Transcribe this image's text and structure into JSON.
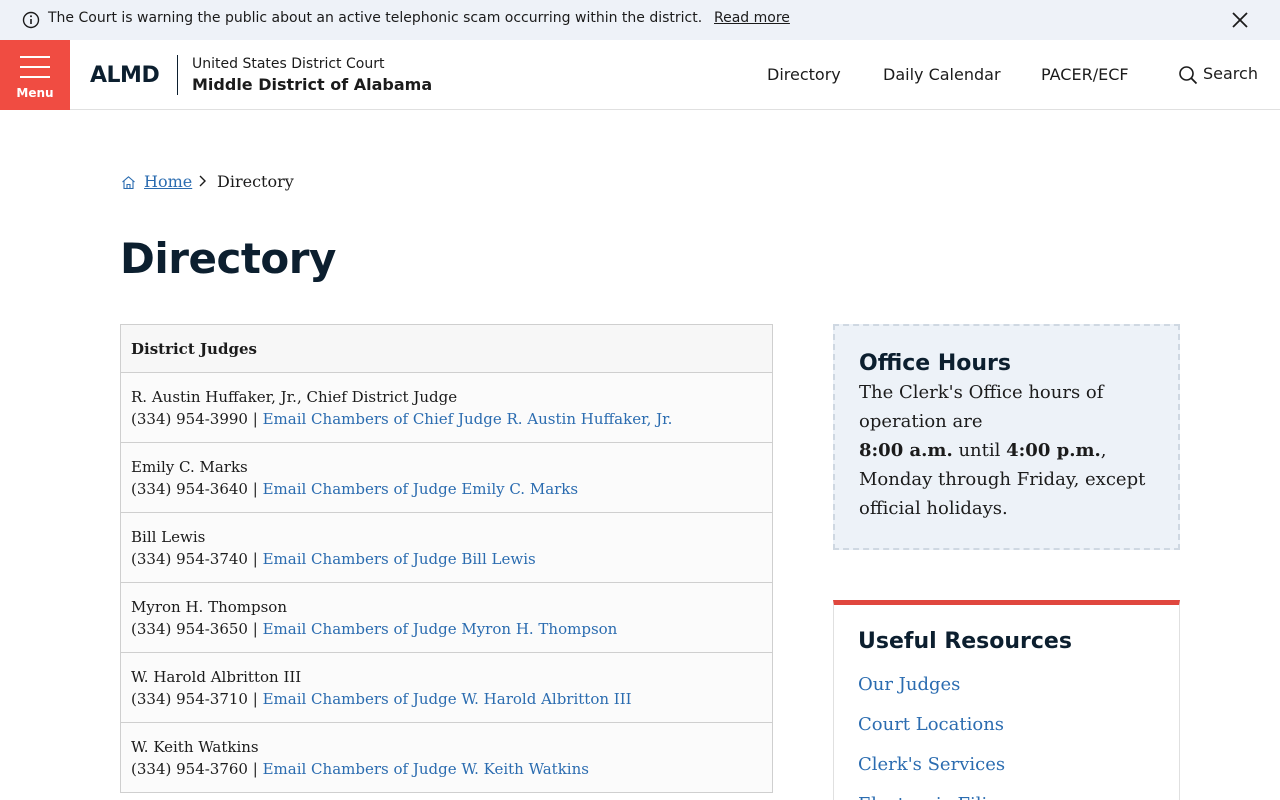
{
  "alert": {
    "message": "The Court is warning the public about an active telephonic scam occurring within the district.",
    "link": "Read more"
  },
  "header": {
    "menu_label": "Menu",
    "logo": "ALMD",
    "court_line1": "United States District Court",
    "court_line2": "Middle District of Alabama",
    "nav": [
      "Directory",
      "Daily Calendar",
      "PACER/ECF"
    ],
    "search_label": "Search"
  },
  "breadcrumb": {
    "home": "Home",
    "current": "Directory"
  },
  "page_title": "Directory",
  "table": {
    "header": "District Judges",
    "rows": [
      {
        "name": "R. Austin Huffaker, Jr., Chief District Judge",
        "phone": "(334) 954-3990",
        "sep": " | ",
        "email": "Email Chambers of Chief Judge R. Austin Huffaker, Jr."
      },
      {
        "name": "Emily C. Marks",
        "phone": "(334) 954-3640",
        "sep": " | ",
        "email": "Email Chambers of Judge Emily C. Marks"
      },
      {
        "name": "Bill Lewis",
        "phone": "(334) 954-3740",
        "sep": " | ",
        "email": "Email Chambers of Judge Bill Lewis"
      },
      {
        "name": "Myron H. Thompson",
        "phone": "(334) 954-3650",
        "sep": " | ",
        "email": "Email Chambers of Judge Myron H. Thompson"
      },
      {
        "name": "W. Harold Albritton III",
        "phone": "(334) 954-3710",
        "sep": " | ",
        "email": "Email Chambers of Judge W. Harold Albritton III"
      },
      {
        "name": "W. Keith Watkins",
        "phone": "(334) 954-3760",
        "sep": " | ",
        "email": "Email Chambers of Judge W. Keith Watkins"
      }
    ]
  },
  "office_hours": {
    "title": "Office Hours",
    "text1": "The Clerk's Office hours of operation are",
    "start": "8:00 a.m.",
    "until": " until ",
    "end": "4:00 p.m.",
    "text2": ", Monday through Friday, except official holidays."
  },
  "resources": {
    "title": "Useful Resources",
    "links": [
      "Our Judges",
      "Court Locations",
      "Clerk's Services",
      "Electronic Filing"
    ]
  }
}
